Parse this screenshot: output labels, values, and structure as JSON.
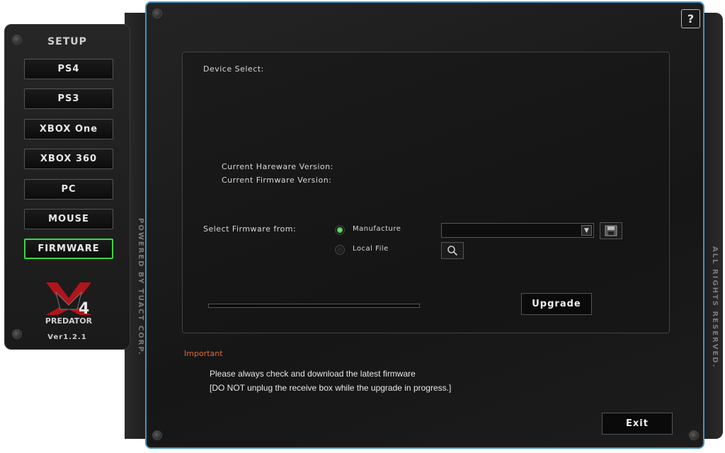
{
  "sidebar": {
    "title": "SETUP",
    "items": [
      {
        "label": "PS4"
      },
      {
        "label": "PS3"
      },
      {
        "label": "XBOX One"
      },
      {
        "label": "XBOX 360"
      },
      {
        "label": "PC"
      },
      {
        "label": "MOUSE"
      },
      {
        "label": "FIRMWARE",
        "active": true
      }
    ],
    "logo_text": "PREDATOR",
    "version": "Ver1.2.1",
    "side_text": "POWERED BY TUACT CORP."
  },
  "right_side_text": "ALL RIGHTS RESERVED.",
  "header": {
    "help_label": "?"
  },
  "firmware": {
    "device_select_label": "Device Select:",
    "hardware_version_label": "Current Hareware Version:",
    "firmware_version_label": "Current Firmware Version:",
    "select_from_label": "Select Firmware from:",
    "options": [
      {
        "label": "Manufacture",
        "selected": true
      },
      {
        "label": "Local File",
        "selected": false
      }
    ],
    "dropdown_value": "",
    "progress": 0,
    "upgrade_label": "Upgrade"
  },
  "notice": {
    "title": "Important",
    "line1": "Please always check and download the latest firmware",
    "line2": "[DO NOT unplug the receive box while the upgrade in progress.]"
  },
  "footer": {
    "exit_label": "Exit"
  },
  "colors": {
    "accent_green": "#3fd34a",
    "important_orange": "#e0683a",
    "frame_blue": "#4d8fb8"
  }
}
